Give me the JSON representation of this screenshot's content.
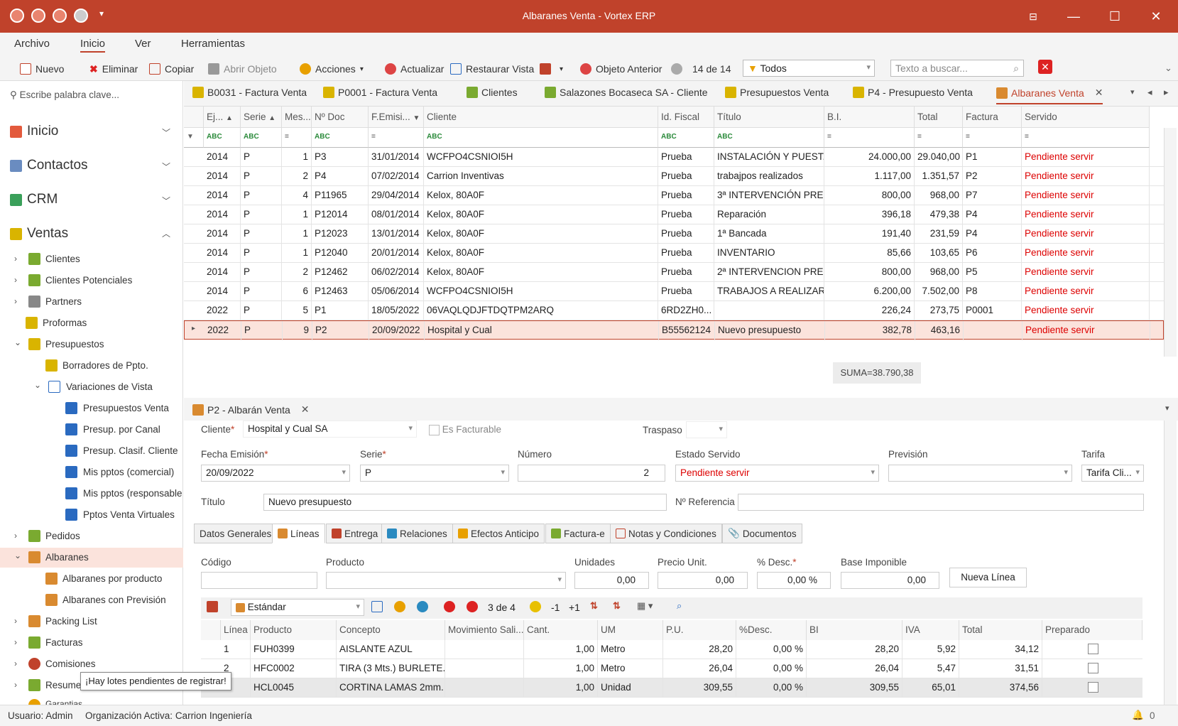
{
  "window": {
    "title": "Albaranes Venta - Vortex ERP"
  },
  "menu": {
    "items": [
      "Archivo",
      "Inicio",
      "Ver",
      "Herramientas"
    ]
  },
  "toolbar": {
    "nuevo": "Nuevo",
    "eliminar": "Eliminar",
    "copiar": "Copiar",
    "abrir_objeto": "Abrir Objeto",
    "acciones": "Acciones",
    "actualizar": "Actualizar",
    "restaurar_vista": "Restaurar Vista",
    "objeto_anterior": "Objeto Anterior",
    "record_counter": "14 de 14",
    "filter_value": "Todos",
    "search_placeholder": "Texto a buscar..."
  },
  "sidebar": {
    "search_placeholder": "Escribe palabra clave...",
    "sections": [
      "Inicio",
      "Contactos",
      "CRM",
      "Ventas"
    ],
    "items": [
      "Clientes",
      "Clientes Potenciales",
      "Partners",
      "Proformas",
      "Presupuestos",
      "Borradores de Ppto.",
      "Variaciones de Vista",
      "Presupuestos Venta",
      "Presup. por Canal",
      "Presup. Clasif. Cliente",
      "Mis pptos (comercial)",
      "Mis pptos (responsable",
      "Pptos Venta Virtuales",
      "Pedidos",
      "Albaranes",
      "Albaranes por producto",
      "Albaranes con Previsión",
      "Packing List",
      "Facturas",
      "Comisiones",
      "Resume",
      "Garantias"
    ]
  },
  "doc_tabs": [
    "B0031 - Factura Venta",
    "P0001 - Factura Venta",
    "Clientes",
    "Salazones Bocaseca SA - Cliente",
    "Presupuestos Venta",
    "P4 - Presupuesto Venta",
    "Albaranes Venta"
  ],
  "grid": {
    "headers": [
      "Ej...",
      "Serie",
      "Mes...",
      "Nº Doc",
      "F.Emisi...",
      "Cliente",
      "Id. Fiscal",
      "Título",
      "B.I.",
      "Total",
      "Factura",
      "Servido"
    ],
    "rows": [
      [
        "2014",
        "P",
        "1",
        "P3",
        "31/01/2014",
        "WCFPO4CSNIOI5H",
        "Prueba",
        "INSTALACIÓN Y PUEST...",
        "24.000,00",
        "29.040,00",
        "P1",
        "Pendiente servir"
      ],
      [
        "2014",
        "P",
        "2",
        "P4",
        "07/02/2014",
        "Carrion Inventivas",
        "Prueba",
        "trabajpos realizados",
        "1.117,00",
        "1.351,57",
        "P2",
        "Pendiente servir"
      ],
      [
        "2014",
        "P",
        "4",
        "P11965",
        "29/04/2014",
        "Kelox, 80A0F",
        "Prueba",
        "3ª INTERVENCIÓN PRE...",
        "800,00",
        "968,00",
        "P7",
        "Pendiente servir"
      ],
      [
        "2014",
        "P",
        "1",
        "P12014",
        "08/01/2014",
        "Kelox, 80A0F",
        "Prueba",
        "Reparación",
        "396,18",
        "479,38",
        "P4",
        "Pendiente servir"
      ],
      [
        "2014",
        "P",
        "1",
        "P12023",
        "13/01/2014",
        "Kelox, 80A0F",
        "Prueba",
        "1ª Bancada",
        "191,40",
        "231,59",
        "P4",
        "Pendiente servir"
      ],
      [
        "2014",
        "P",
        "1",
        "P12040",
        "20/01/2014",
        "Kelox, 80A0F",
        "Prueba",
        "INVENTARIO",
        "85,66",
        "103,65",
        "P6",
        "Pendiente servir"
      ],
      [
        "2014",
        "P",
        "2",
        "P12462",
        "06/02/2014",
        "Kelox, 80A0F",
        "Prueba",
        "2ª  INTERVENCION PRE...",
        "800,00",
        "968,00",
        "P5",
        "Pendiente servir"
      ],
      [
        "2014",
        "P",
        "6",
        "P12463",
        "05/06/2014",
        "WCFPO4CSNIOI5H",
        "Prueba",
        "TRABAJOS A REALIZAR...",
        "6.200,00",
        "7.502,00",
        "P8",
        "Pendiente servir"
      ],
      [
        "2022",
        "P",
        "5",
        "P1",
        "18/05/2022",
        "06VAQLQDJFTDQTPM2ARQ",
        "6RD2ZH0...",
        "",
        "226,24",
        "273,75",
        "P0001",
        "Pendiente servir"
      ],
      [
        "2022",
        "P",
        "9",
        "P2",
        "20/09/2022",
        "Hospital y Cual",
        "B55562124",
        "Nuevo presupuesto",
        "382,78",
        "463,16",
        "",
        "Pendiente servir"
      ]
    ],
    "suma": "SUMA=38.790,38"
  },
  "detail": {
    "tab_label": "P2 - Albarán Venta",
    "cliente_label": "Cliente",
    "cliente": "Hospital y Cual SA",
    "facturable_label": "Es Facturable",
    "traspaso_label": "Traspaso",
    "fecha_label": "Fecha Emisión",
    "fecha": "20/09/2022",
    "serie_label": "Serie",
    "serie": "P",
    "numero_label": "Número",
    "numero": "2",
    "estado_label": "Estado Servido",
    "estado": "Pendiente servir",
    "prevision_label": "Previsión",
    "tarifa_label": "Tarifa",
    "tarifa": "Tarifa Cli...",
    "titulo_label": "Título",
    "titulo": "Nuevo presupuesto",
    "referencia_label": "Nº Referencia"
  },
  "inner_tabs": [
    "Datos Generales",
    "Líneas",
    "Entrega",
    "Relaciones",
    "Efectos Anticipo",
    "Factura-e",
    "Notas y Condiciones",
    "Documentos"
  ],
  "lineas_form": {
    "codigo_label": "Código",
    "producto_label": "Producto",
    "unidades_label": "Unidades",
    "unidades": "0,00",
    "precio_label": "Precio Unit.",
    "precio": "0,00",
    "desc_label": "% Desc.",
    "desc": "0,00 %",
    "base_label": "Base Imponible",
    "base": "0,00",
    "nueva_linea": "Nueva Línea",
    "vista": "Estándar",
    "counter": "3 de 4",
    "minus": "-1",
    "plus": "+1"
  },
  "lines": {
    "headers": [
      "Línea",
      "Producto",
      "Concepto",
      "Movimiento Sali...",
      "Cant.",
      "UM",
      "P.U.",
      "%Desc.",
      "BI",
      "IVA",
      "Total",
      "Preparado"
    ],
    "rows": [
      [
        "1",
        "FUH0399",
        "AISLANTE AZUL",
        "",
        "1,00",
        "Metro",
        "28,20",
        "0,00 %",
        "28,20",
        "5,92",
        "34,12"
      ],
      [
        "2",
        "HFC0002",
        "TIRA (3 Mts.) BURLETE...",
        "",
        "1,00",
        "Metro",
        "26,04",
        "0,00 %",
        "26,04",
        "5,47",
        "31,51"
      ],
      [
        "3",
        "HCL0045",
        "CORTINA LAMAS 2mm....",
        "",
        "1,00",
        "Unidad",
        "309,55",
        "0,00 %",
        "309,55",
        "65,01",
        "374,56"
      ]
    ]
  },
  "tooltip": "¡Hay lotes pendientes de registrar!",
  "status": {
    "usuario": "Usuario: Admin",
    "organizacion": "Organización Activa: Carrion Ingeniería"
  },
  "colors": {
    "accent": "#c0422b",
    "selected_row": "#fbe3dc",
    "pending": "#dd0000"
  }
}
